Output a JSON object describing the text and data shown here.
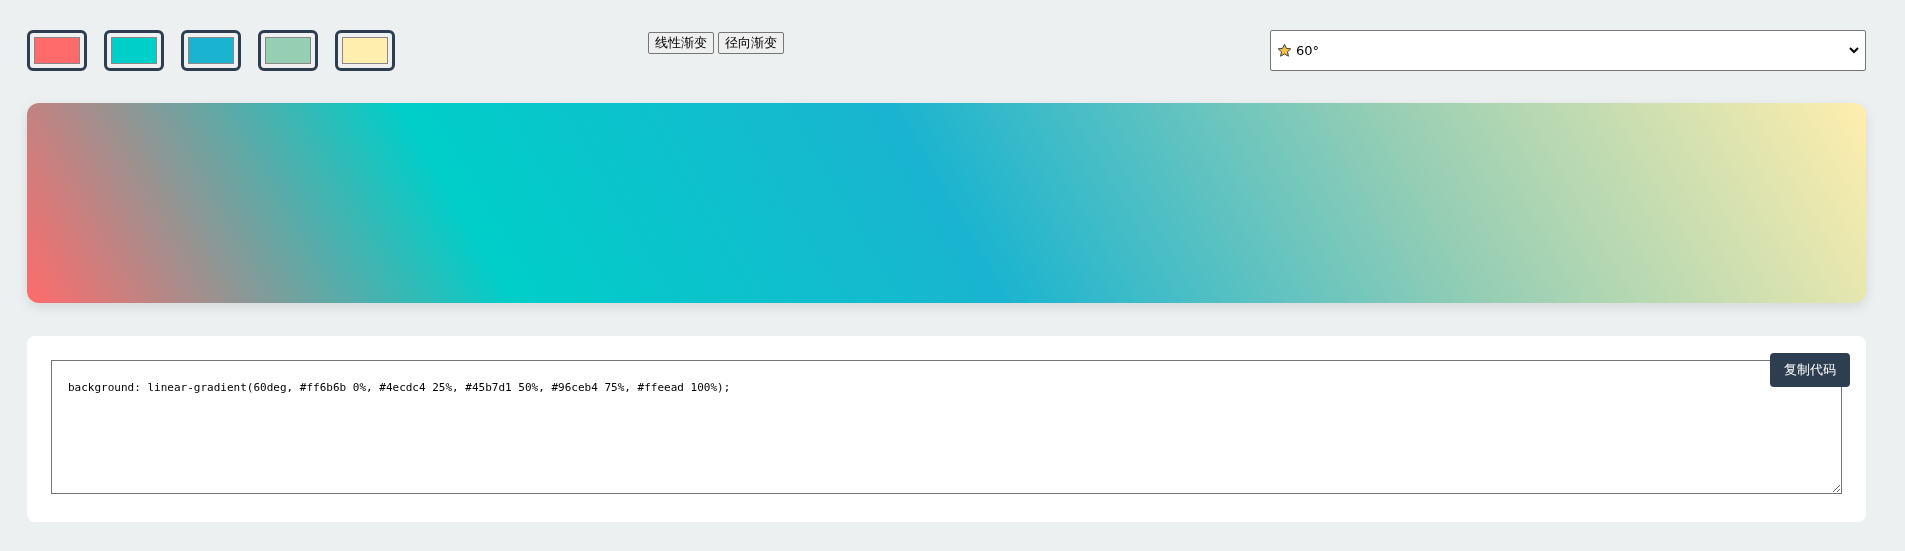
{
  "swatches": [
    {
      "color": "#ff6b6b"
    },
    {
      "color": "#00cec9"
    },
    {
      "color": "#1ab4d0"
    },
    {
      "color": "#96ceb4"
    },
    {
      "color": "#ffeead"
    }
  ],
  "gradient_type_buttons": [
    {
      "label": "线性渐变"
    },
    {
      "label": "径向渐变"
    }
  ],
  "angle_select": {
    "value": "60°"
  },
  "code_panel": {
    "code": "background: linear-gradient(60deg, #ff6b6b 0%, #4ecdc4 25%, #45b7d1 50%, #96ceb4 75%, #ffeead 100%);",
    "copy_button": "复制代码"
  }
}
